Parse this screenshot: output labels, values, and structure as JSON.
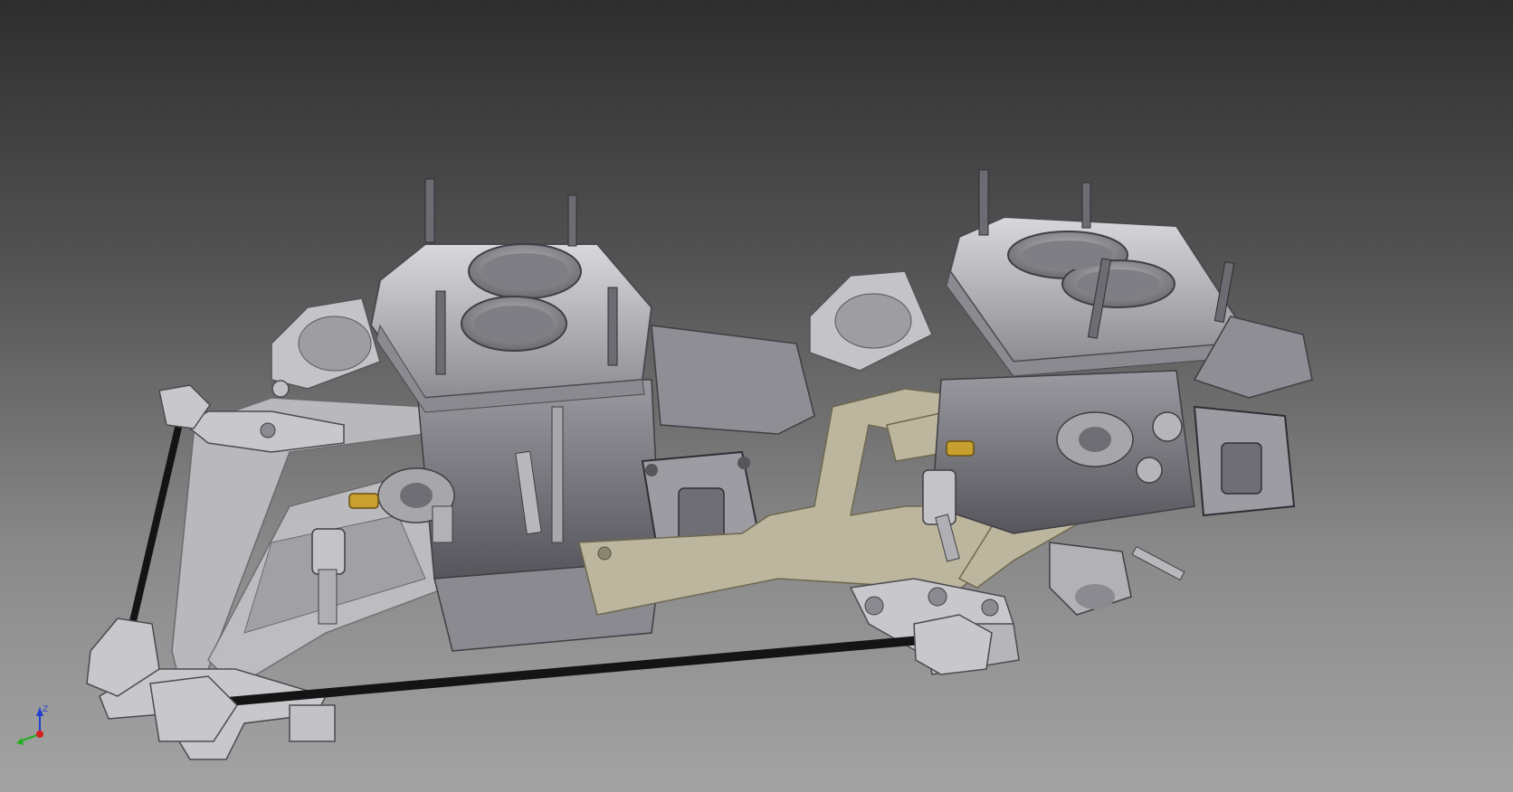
{
  "colors": {
    "background_top": "#2e2e2e",
    "background_bottom": "#a3a3a3",
    "metal_light": "#c9c9cc",
    "metal_mid": "#9a9aa0",
    "metal_dark": "#5e5e64",
    "gasket": "#bdb69e",
    "linkage_rod": "#141414",
    "brass_fitting": "#c8a030",
    "axis_x": "#d42020",
    "axis_y": "#20b020",
    "axis_z": "#2040d0"
  },
  "triad": {
    "z_label": "Z",
    "x_label": "",
    "y_label": ""
  },
  "icons": {
    "triad": "coordinate-triad-icon"
  }
}
